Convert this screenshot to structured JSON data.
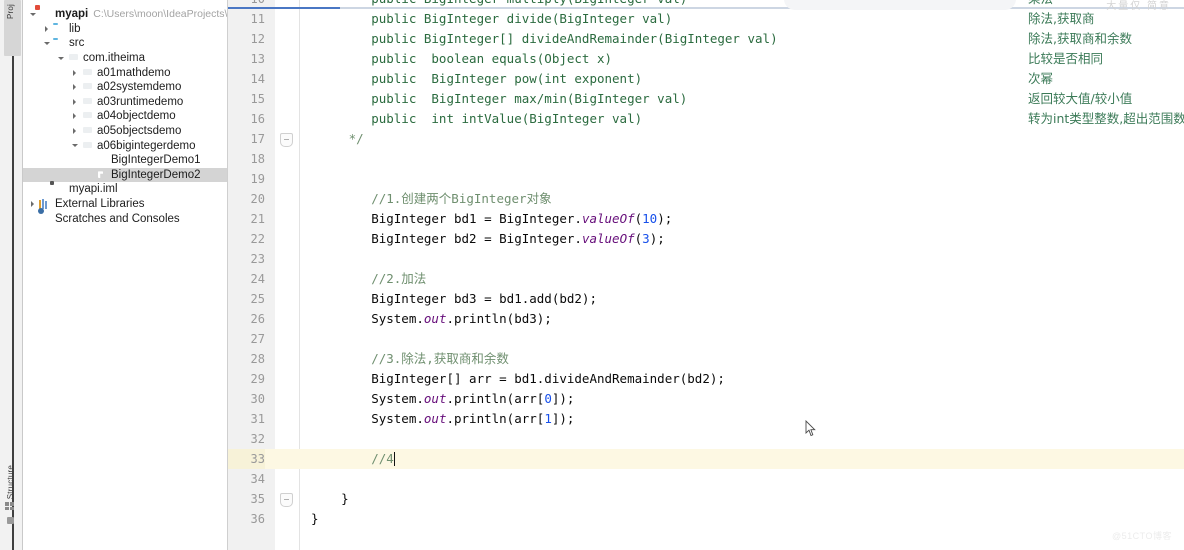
{
  "toolstrip": {
    "project_label": "Proj",
    "structure_label": "Structure",
    "project_icon": "folder-icon",
    "structure_icon": "grid-icon"
  },
  "project_panel": {
    "tree": [
      {
        "depth": 0,
        "arrow": "open",
        "icon": "module-icon",
        "label": "myapi",
        "bold": true,
        "path": "C:\\Users\\moon\\IdeaProjects\\basic-code\\",
        "selected": false
      },
      {
        "depth": 1,
        "arrow": "closed",
        "icon": "folder-icon",
        "label": "lib",
        "bold": false,
        "path": "",
        "selected": false
      },
      {
        "depth": 1,
        "arrow": "open",
        "icon": "folder-icon",
        "label": "src",
        "bold": false,
        "path": "",
        "selected": false
      },
      {
        "depth": 2,
        "arrow": "open",
        "icon": "package-icon",
        "label": "com.itheima",
        "bold": false,
        "path": "",
        "selected": false
      },
      {
        "depth": 3,
        "arrow": "closed",
        "icon": "package-icon",
        "label": "a01mathdemo",
        "bold": false,
        "path": "",
        "selected": false
      },
      {
        "depth": 3,
        "arrow": "closed",
        "icon": "package-icon",
        "label": "a02systemdemo",
        "bold": false,
        "path": "",
        "selected": false
      },
      {
        "depth": 3,
        "arrow": "closed",
        "icon": "package-icon",
        "label": "a03runtimedemo",
        "bold": false,
        "path": "",
        "selected": false
      },
      {
        "depth": 3,
        "arrow": "closed",
        "icon": "package-icon",
        "label": "a04objectdemo",
        "bold": false,
        "path": "",
        "selected": false
      },
      {
        "depth": 3,
        "arrow": "closed",
        "icon": "package-icon",
        "label": "a05objectsdemo",
        "bold": false,
        "path": "",
        "selected": false
      },
      {
        "depth": 3,
        "arrow": "open",
        "icon": "package-icon",
        "label": "a06bigintegerdemo",
        "bold": false,
        "path": "",
        "selected": false
      },
      {
        "depth": 4,
        "arrow": "none",
        "icon": "java-class-icon",
        "label": "BigIntegerDemo1",
        "bold": false,
        "path": "",
        "selected": false
      },
      {
        "depth": 4,
        "arrow": "none",
        "icon": "java-class-icon",
        "label": "BigIntegerDemo2",
        "bold": false,
        "path": "",
        "selected": true
      },
      {
        "depth": 1,
        "arrow": "none",
        "icon": "iml-file-icon",
        "label": "myapi.iml",
        "bold": false,
        "path": "",
        "selected": false
      },
      {
        "depth": 0,
        "arrow": "closed",
        "icon": "external-libraries-icon",
        "label": "External Libraries",
        "bold": false,
        "path": "",
        "selected": false
      },
      {
        "depth": 0,
        "arrow": "none",
        "icon": "scratches-icon",
        "label": "Scratches and Consoles",
        "bold": false,
        "path": "",
        "selected": false
      }
    ]
  },
  "editor": {
    "highlighted_line": 33,
    "caret_line": 33,
    "lines": [
      {
        "num": "10",
        "text": "        public BigInteger multiply(BigInteger val)",
        "anno": "乘法",
        "clipped": true,
        "fold": false
      },
      {
        "num": "11",
        "text": "        public BigInteger divide(BigInteger val)",
        "anno": "除法,获取商",
        "clipped": false,
        "fold": false
      },
      {
        "num": "12",
        "text": "        public BigInteger[] divideAndRemainder(BigInteger val)",
        "anno": "除法,获取商和余数",
        "clipped": false,
        "fold": false
      },
      {
        "num": "13",
        "text": "        public  boolean equals(Object x)",
        "anno": "比较是否相同",
        "clipped": false,
        "fold": false
      },
      {
        "num": "14",
        "text": "        public  BigInteger pow(int exponent)",
        "anno": "次幂",
        "clipped": false,
        "fold": false
      },
      {
        "num": "15",
        "text": "        public  BigInteger max/min(BigInteger val)",
        "anno": "返回较大值/较小值",
        "clipped": false,
        "fold": false
      },
      {
        "num": "16",
        "text": "        public  int intValue(BigInteger val)",
        "anno": "转为int类型整数,超出范围数据有误",
        "clipped": false,
        "fold": false
      },
      {
        "num": "17",
        "text": "     */",
        "anno": "",
        "clipped": false,
        "fold": true
      },
      {
        "num": "18",
        "text": "",
        "anno": "",
        "clipped": false,
        "fold": false
      },
      {
        "num": "19",
        "text": "",
        "anno": "",
        "clipped": false,
        "fold": false
      },
      {
        "num": "20",
        "text": "        //1.创建两个BigInteger对象",
        "anno": "",
        "clipped": false,
        "fold": false
      },
      {
        "num": "21",
        "text": "        BigInteger bd1 = BigInteger.valueOf(10);",
        "anno": "",
        "clipped": false,
        "fold": false
      },
      {
        "num": "22",
        "text": "        BigInteger bd2 = BigInteger.valueOf(3);",
        "anno": "",
        "clipped": false,
        "fold": false
      },
      {
        "num": "23",
        "text": "",
        "anno": "",
        "clipped": false,
        "fold": false
      },
      {
        "num": "24",
        "text": "        //2.加法",
        "anno": "",
        "clipped": false,
        "fold": false
      },
      {
        "num": "25",
        "text": "        BigInteger bd3 = bd1.add(bd2);",
        "anno": "",
        "clipped": false,
        "fold": false
      },
      {
        "num": "26",
        "text": "        System.out.println(bd3);",
        "anno": "",
        "clipped": false,
        "fold": false
      },
      {
        "num": "27",
        "text": "",
        "anno": "",
        "clipped": false,
        "fold": false
      },
      {
        "num": "28",
        "text": "        //3.除法,获取商和余数",
        "anno": "",
        "clipped": false,
        "fold": false
      },
      {
        "num": "29",
        "text": "        BigInteger[] arr = bd1.divideAndRemainder(bd2);",
        "anno": "",
        "clipped": false,
        "fold": false
      },
      {
        "num": "30",
        "text": "        System.out.println(arr[0]);",
        "anno": "",
        "clipped": false,
        "fold": false
      },
      {
        "num": "31",
        "text": "        System.out.println(arr[1]);",
        "anno": "",
        "clipped": false,
        "fold": false
      },
      {
        "num": "32",
        "text": "",
        "anno": "",
        "clipped": false,
        "fold": false
      },
      {
        "num": "33",
        "text": "        //4",
        "anno": "",
        "clipped": false,
        "fold": false
      },
      {
        "num": "34",
        "text": "",
        "anno": "",
        "clipped": false,
        "fold": false
      },
      {
        "num": "35",
        "text": "    }",
        "anno": "",
        "clipped": false,
        "fold": true
      },
      {
        "num": "36",
        "text": "}",
        "anno": "",
        "clipped": false,
        "fold": false
      }
    ]
  },
  "overlays": {
    "top_right_text": "大量仅   简意",
    "watermark": "@51CTO博客"
  },
  "colors": {
    "comment": "#6f8f6f",
    "javadoc_annotation": "#3b7a57",
    "keyword": "#0033b3",
    "number": "#1750eb",
    "field": "#660e7a",
    "selection": "#d4d4d4",
    "caret_line": "#fdf8e3",
    "gutter": "#f1f1f1"
  }
}
